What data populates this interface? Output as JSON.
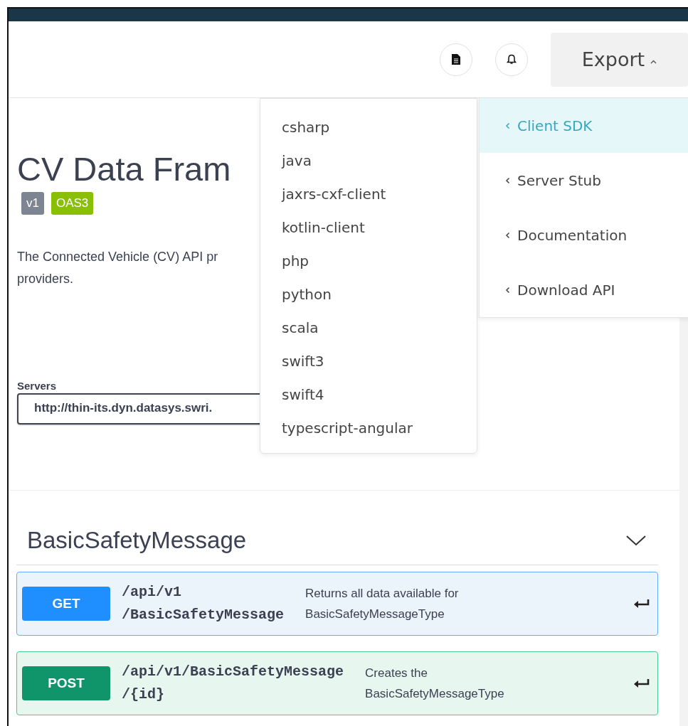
{
  "header": {
    "export_label": "Export"
  },
  "info": {
    "title": "CV Data Fram",
    "badges": [
      {
        "text": "v1",
        "color": "#7d8492"
      },
      {
        "text": "OAS3",
        "color": "#89bf04"
      }
    ],
    "description": [
      "The Connected Vehicle (CV) API pr",
      "providers."
    ],
    "servers_label": "Servers",
    "server_value": "http://thin-its.dyn.datasys.swri."
  },
  "language_menu": [
    "csharp",
    "java",
    "jaxrs-cxf-client",
    "kotlin-client",
    "php",
    "python",
    "scala",
    "swift3",
    "swift4",
    "typescript-angular"
  ],
  "export_menu": [
    {
      "label": "Client SDK",
      "selected": true
    },
    {
      "label": "Server Stub",
      "selected": false
    },
    {
      "label": "Documentation",
      "selected": false
    },
    {
      "label": "Download API",
      "selected": false
    }
  ],
  "section": {
    "title": "BasicSafetyMessage",
    "operations": [
      {
        "method": "GET",
        "color": "#1f8fff",
        "path": [
          "/api/v1",
          "/BasicSafetyMessage"
        ],
        "summary": [
          "Returns all data available for",
          "BasicSafetyMessageType"
        ]
      },
      {
        "method": "POST",
        "color": "#10956a",
        "path": [
          "/api/v1/BasicSafetyMessage",
          "/{id}"
        ],
        "summary": [
          "Creates the",
          "BasicSafetyMessageType"
        ]
      }
    ]
  }
}
